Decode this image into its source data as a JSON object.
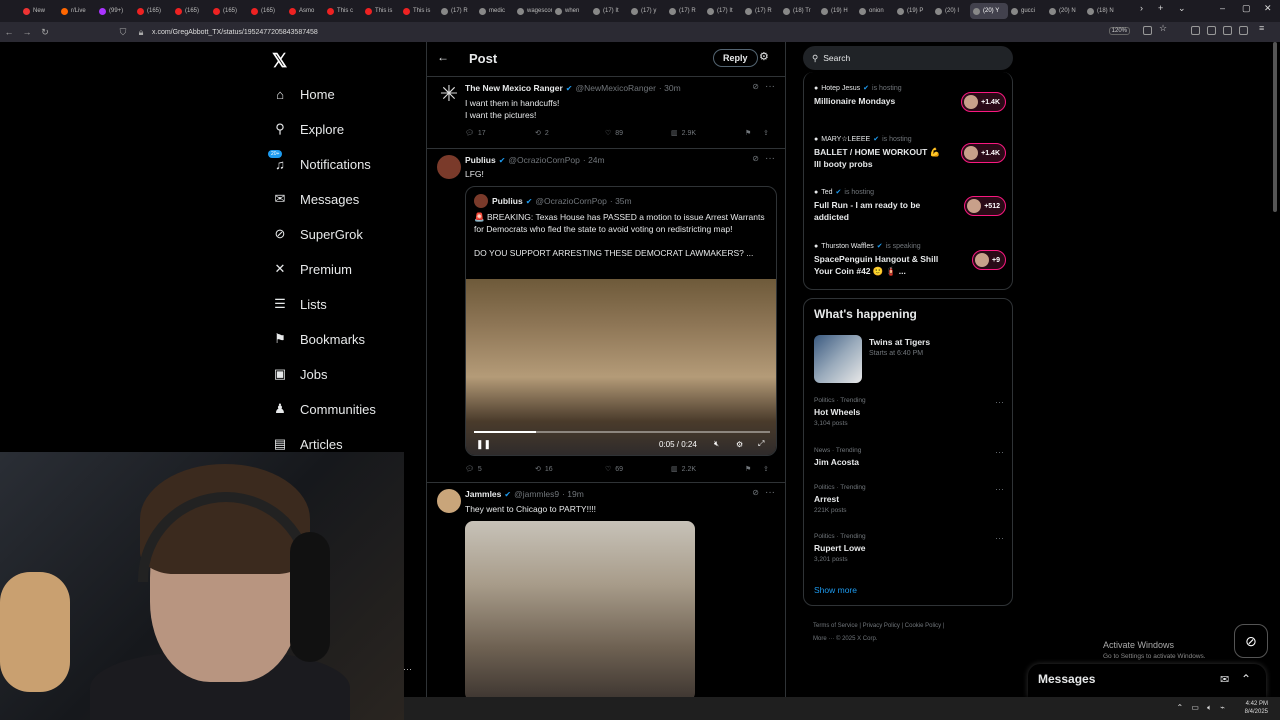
{
  "browser": {
    "tabs": [
      {
        "label": "New",
        "color": "#e33"
      },
      {
        "label": "r/Live",
        "color": "#f60"
      },
      {
        "label": "(99+)",
        "color": "#a3f"
      },
      {
        "label": "(165)",
        "color": "#e22"
      },
      {
        "label": "(165)",
        "color": "#e22"
      },
      {
        "label": "(165)",
        "color": "#e22"
      },
      {
        "label": "(165)",
        "color": "#e22"
      },
      {
        "label": "Asmo",
        "color": "#e22"
      },
      {
        "label": "This c",
        "color": "#e22"
      },
      {
        "label": "This is",
        "color": "#e22"
      },
      {
        "label": "This is",
        "color": "#e22"
      },
      {
        "label": "(17) R",
        "color": "#888"
      },
      {
        "label": "medic",
        "color": "#888"
      },
      {
        "label": "wagescom",
        "color": "#888"
      },
      {
        "label": "when",
        "color": "#888"
      },
      {
        "label": "(17) It",
        "color": "#888"
      },
      {
        "label": "(17) y",
        "color": "#888"
      },
      {
        "label": "(17) R",
        "color": "#888"
      },
      {
        "label": "(17) It",
        "color": "#888"
      },
      {
        "label": "(17) R",
        "color": "#888"
      },
      {
        "label": "(18) Tr",
        "color": "#888"
      },
      {
        "label": "(19) H",
        "color": "#888"
      },
      {
        "label": "onion",
        "color": "#888"
      },
      {
        "label": "(19) P",
        "color": "#888"
      },
      {
        "label": "(20) I",
        "color": "#888"
      },
      {
        "label": "(20) Y",
        "color": "#888",
        "active": true
      },
      {
        "label": "gucci",
        "color": "#888"
      },
      {
        "label": "(20) N",
        "color": "#888"
      },
      {
        "label": "(18) N",
        "color": "#888"
      }
    ],
    "url": "x.com/GregAbbott_TX/status/1952477205843587458",
    "zoom": "120%"
  },
  "sidebar": {
    "logo": "𝕏",
    "items": [
      {
        "label": "Home",
        "icon": "home-icon",
        "glyph": "⌂"
      },
      {
        "label": "Explore",
        "icon": "search-icon",
        "glyph": "⚲"
      },
      {
        "label": "Notifications",
        "icon": "bell-icon",
        "glyph": "♫",
        "badge": "20+"
      },
      {
        "label": "Messages",
        "icon": "envelope-icon",
        "glyph": "✉"
      },
      {
        "label": "SuperGrok",
        "icon": "grok-icon",
        "glyph": "⊘"
      },
      {
        "label": "Premium",
        "icon": "x-premium-icon",
        "glyph": "✕"
      },
      {
        "label": "Lists",
        "icon": "list-icon",
        "glyph": "☰"
      },
      {
        "label": "Bookmarks",
        "icon": "bookmark-icon",
        "glyph": "⚑"
      },
      {
        "label": "Jobs",
        "icon": "briefcase-icon",
        "glyph": "▣"
      },
      {
        "label": "Communities",
        "icon": "people-icon",
        "glyph": "♟"
      },
      {
        "label": "Articles",
        "icon": "article-icon",
        "glyph": "▤"
      }
    ]
  },
  "feed": {
    "back": "←",
    "title": "Post",
    "reply_label": "Reply",
    "posts": [
      {
        "name": "The New Mexico Ranger",
        "handle": "@NewMexicoRanger",
        "time": "· 30m",
        "text": "I want them in handcuffs!\nI want the pictures!",
        "avatar_color": "#ddd",
        "replies": "17",
        "reposts": "2",
        "likes": "89",
        "views": "2.9K"
      },
      {
        "name": "Publius",
        "handle": "@OcrazioCornPop",
        "time": "· 24m",
        "text": "LFG!",
        "avatar_color": "#7a3a2a",
        "quote": {
          "name": "Publius",
          "handle": "@OcrazioCornPop",
          "time": "· 35m",
          "text": "🚨 BREAKING: Texas House has PASSED a motion to issue Arrest Warrants for Democrats who fled the state to avoid voting on redistricting map!\n\nDO YOU SUPPORT ARRESTING THESE DEMOCRAT LAWMAKERS? ...",
          "video_time": "0:05 / 0:24",
          "video_progress": 0.21
        },
        "replies": "5",
        "reposts": "16",
        "likes": "69",
        "views": "2.2K"
      },
      {
        "name": "Jammles",
        "handle": "@jammles9",
        "time": "· 19m",
        "text": "They went to Chicago to PARTY!!!!",
        "avatar_color": "#c9a57a"
      }
    ]
  },
  "right": {
    "search_placeholder": "Search",
    "spaces": [
      {
        "host": "Hotep Jesus",
        "status": "is hosting",
        "title": "Millionaire Mondays",
        "count": "+1.4K"
      },
      {
        "host": "MARY☆LEEEE",
        "status": "is hosting",
        "title": "BALLET / HOME WORKOUT 💪 lll booty probs",
        "count": "+1.4K"
      },
      {
        "host": "Ted",
        "status": "is hosting",
        "title": "Full Run - I am ready to be addicted",
        "count": "+512"
      },
      {
        "host": "Thurston Waffles",
        "status": "is speaking",
        "title": "SpacePenguin Hangout & Shill Your Coin #42 🙂 🧯 ...",
        "count": "+9"
      }
    ],
    "happening_title": "What's happening",
    "event": {
      "title": "Twins at Tigers",
      "time": "Starts at 6:40 PM"
    },
    "trends": [
      {
        "category": "Politics · Trending",
        "name": "Hot Wheels",
        "posts": "3,104 posts"
      },
      {
        "category": "News · Trending",
        "name": "Jim Acosta",
        "posts": ""
      },
      {
        "category": "Politics · Trending",
        "name": "Arrest",
        "posts": "221K posts"
      },
      {
        "category": "Politics · Trending",
        "name": "Rupert Lowe",
        "posts": "3,201 posts"
      }
    ],
    "show_more": "Show more",
    "footer_line1": "Terms of Service  |  Privacy Policy  |  Cookie Policy  |",
    "footer_line2": "More ···   © 2025 X Corp."
  },
  "overlay": {
    "activate_title": "Activate Windows",
    "activate_sub": "Go to Settings to activate Windows.",
    "messages_title": "Messages"
  },
  "taskbar": {
    "time": "4:42 PM",
    "date": "8/4/2025"
  }
}
